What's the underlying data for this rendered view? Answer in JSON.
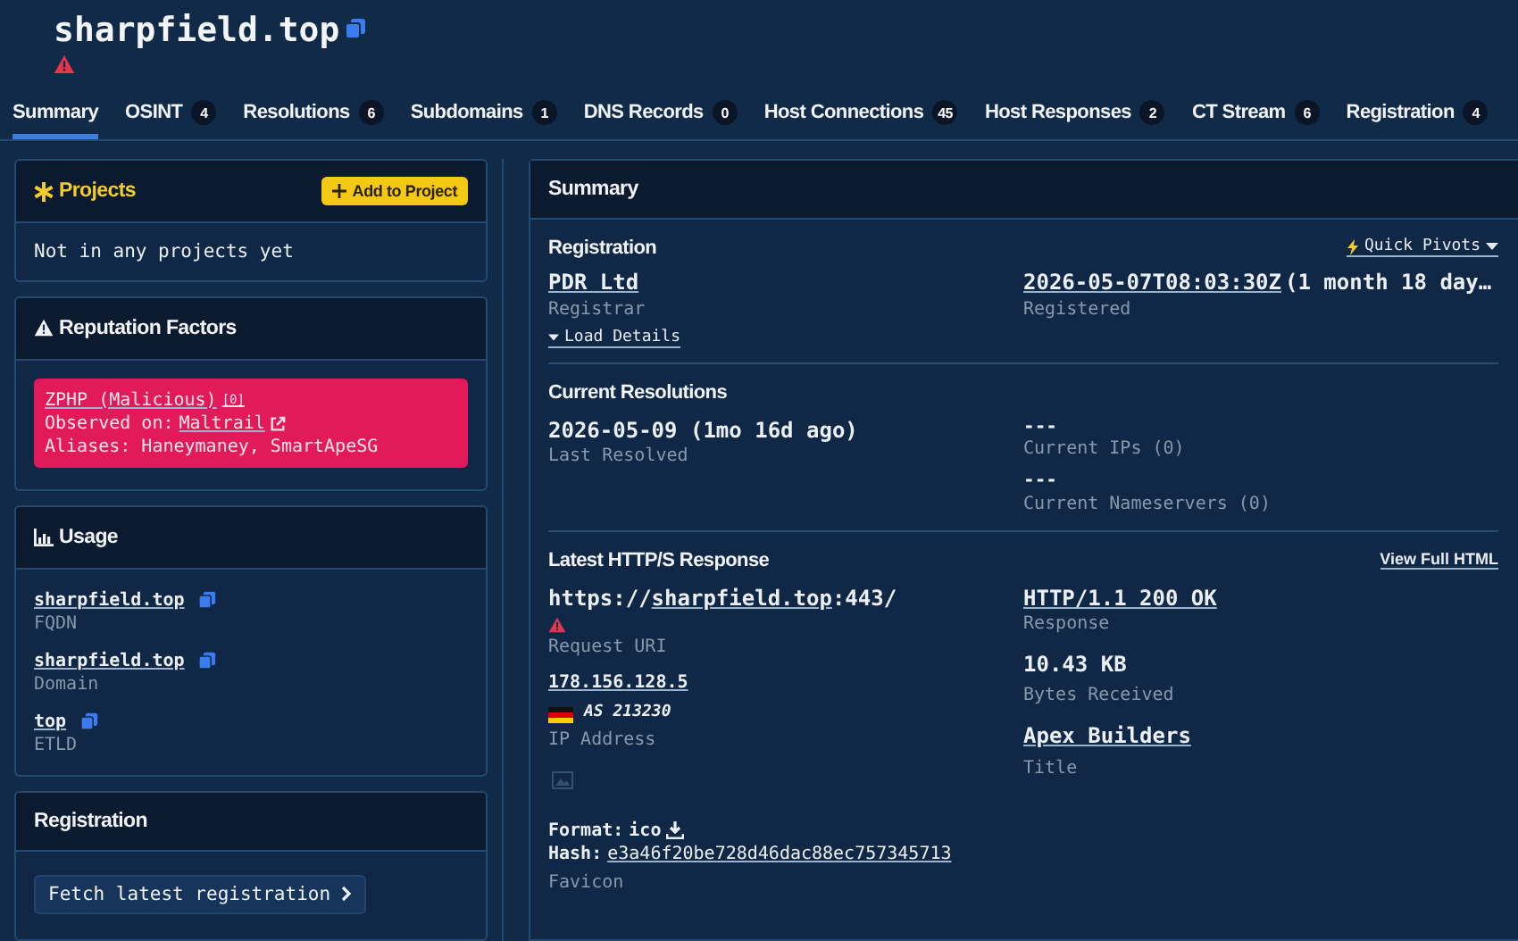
{
  "header": {
    "title": "sharpfield.top",
    "warning": true
  },
  "tabs": [
    {
      "label": "Summary",
      "selected": true
    },
    {
      "label": "OSINT",
      "count": "4",
      "selected": false
    },
    {
      "label": "Resolutions",
      "count": "6",
      "selected": false
    },
    {
      "label": "Subdomains",
      "count": "1",
      "selected": false
    },
    {
      "label": "DNS Records",
      "count": "0",
      "selected": false
    },
    {
      "label": "Host Connections",
      "count": "45",
      "selected": false
    },
    {
      "label": "Host Responses",
      "count": "2",
      "selected": false
    },
    {
      "label": "CT Stream",
      "count": "6",
      "selected": false
    },
    {
      "label": "Registration",
      "count": "4",
      "selected": false
    }
  ],
  "projects": {
    "title": "Projects",
    "button": "Add to Project",
    "empty": "Not in any projects yet"
  },
  "reputation": {
    "title": "Reputation Factors",
    "factors": [
      {
        "name": "ZPHP (Malicious)",
        "ref": "[0]",
        "observed_label": "Observed on:",
        "source": "Maltrail",
        "aliases": "Aliases: Haneymaney, SmartApeSG"
      }
    ]
  },
  "usage": {
    "title": "Usage",
    "items": [
      {
        "value": "sharpfield.top",
        "type": "FQDN"
      },
      {
        "value": "sharpfield.top",
        "type": "Domain"
      },
      {
        "value": "top",
        "type": "ETLD"
      }
    ]
  },
  "registration_card": {
    "title": "Registration",
    "button": "Fetch latest registration"
  },
  "summary": {
    "title": "Summary",
    "registration": {
      "title": "Registration",
      "pivots": "Quick Pivots",
      "registrar": {
        "value": "PDR Ltd",
        "label": "Registrar"
      },
      "registered": {
        "value": "2026-05-07T08:03:30Z",
        "note": "(1 month 18 day…",
        "label": "Registered"
      },
      "load_details": "Load Details"
    },
    "resolutions": {
      "title": "Current Resolutions",
      "last": {
        "value": "2026-05-09 (1mo 16d ago)",
        "label": "Last Resolved"
      },
      "ips": {
        "value": "---",
        "label": "Current IPs (0)"
      },
      "nameservers": {
        "value": "---",
        "label": "Current Nameservers (0)"
      }
    },
    "http": {
      "title": "Latest HTTP/S Response",
      "view": "View Full HTML",
      "uri": {
        "scheme": "https://",
        "host": "sharpfield.top",
        "suffix": ":443/",
        "warning": true,
        "label": "Request URI"
      },
      "ip": {
        "value": "178.156.128.5",
        "asn": "AS 213230",
        "label": "IP Address"
      },
      "favicon": {
        "format_label": "Format:",
        "format": "ico",
        "hash_label": "Hash:",
        "hash": "e3a46f20be728d46dac88ec757345713",
        "label": "Favicon"
      },
      "response": {
        "value": "HTTP/1.1 200 OK",
        "label": "Response"
      },
      "bytes": {
        "value": "10.43 KB",
        "label": "Bytes Received"
      },
      "page_title": {
        "value": "Apex Builders",
        "label": "Title"
      }
    }
  }
}
